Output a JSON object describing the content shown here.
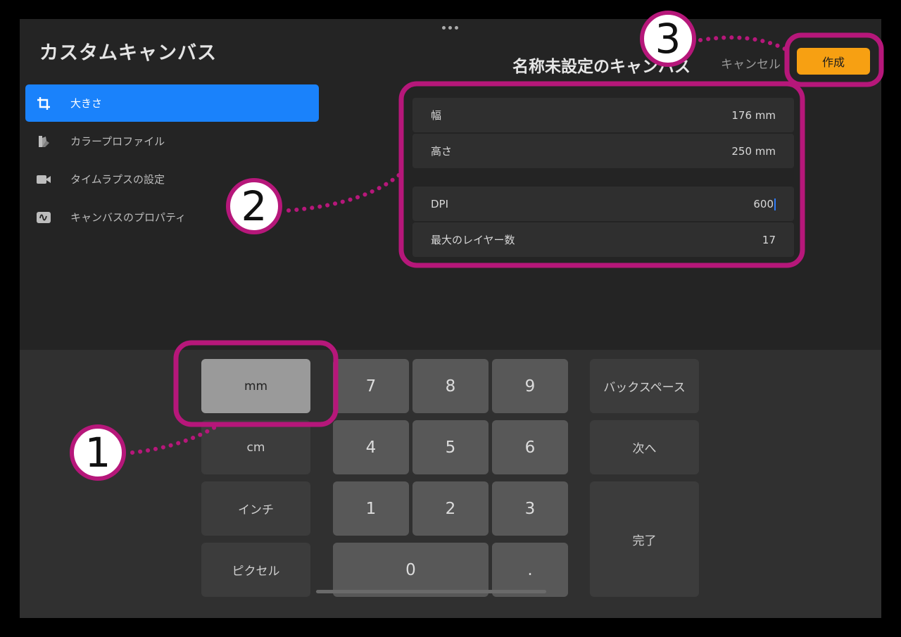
{
  "panel": {
    "title": "カスタムキャンバス"
  },
  "sidebar": {
    "items": [
      {
        "label": "大きさ",
        "icon": "crop-icon",
        "active": true
      },
      {
        "label": "カラープロファイル",
        "icon": "color-swatch-icon",
        "active": false
      },
      {
        "label": "タイムラプスの設定",
        "icon": "video-camera-icon",
        "active": false
      },
      {
        "label": "キャンバスのプロパティ",
        "icon": "canvas-properties-icon",
        "active": false
      }
    ]
  },
  "header": {
    "canvas_name": "名称未設定のキャンバス",
    "cancel_label": "キャンセル",
    "create_label": "作成"
  },
  "fields": {
    "width": {
      "label": "幅",
      "value": "176 mm"
    },
    "height": {
      "label": "高さ",
      "value": "250 mm"
    },
    "dpi": {
      "label": "DPI",
      "value": "600"
    },
    "max_layers": {
      "label": "最大のレイヤー数",
      "value": "17"
    }
  },
  "keyboard": {
    "units": [
      "mm",
      "cm",
      "インチ",
      "ピクセル"
    ],
    "selected_unit": "mm",
    "digits": [
      "7",
      "8",
      "9",
      "4",
      "5",
      "6",
      "1",
      "2",
      "3",
      "0",
      "."
    ],
    "backspace_label": "バックスペース",
    "next_label": "次へ",
    "done_label": "完了"
  },
  "callouts": [
    "1",
    "2",
    "3"
  ],
  "colors": {
    "accent_blue": "#1a82fb",
    "create_orange": "#f7a012",
    "callout_magenta": "#b6177a"
  }
}
